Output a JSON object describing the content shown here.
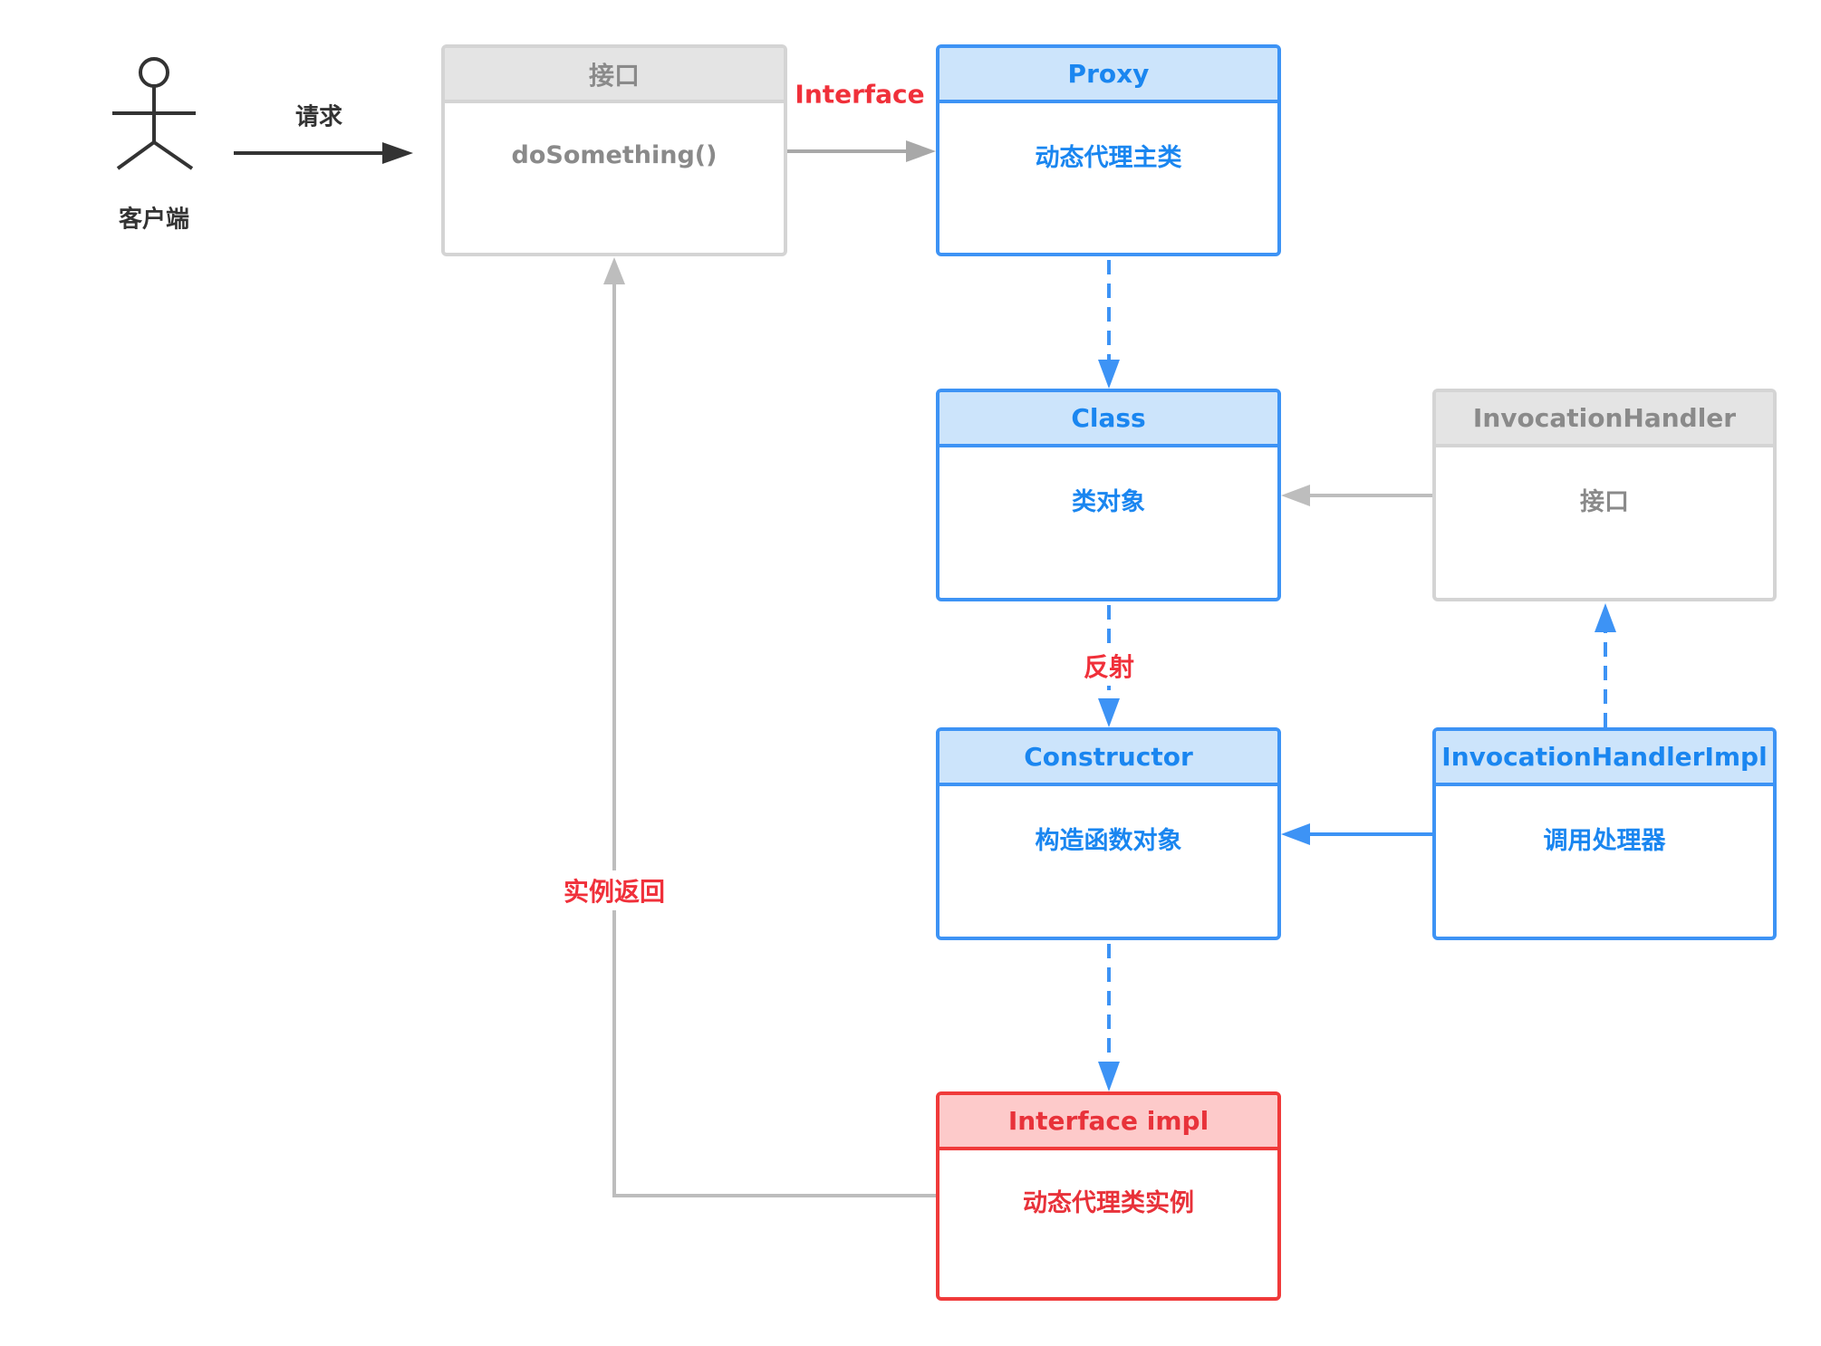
{
  "actor": {
    "label": "客户端"
  },
  "edges": {
    "request": "请求",
    "interface": "Interface",
    "reflection": "反射",
    "instance_return": "实例返回"
  },
  "nodes": {
    "interface_box": {
      "title": "接口",
      "body": "doSomething()"
    },
    "proxy": {
      "title": "Proxy",
      "body": "动态代理主类"
    },
    "class": {
      "title": "Class",
      "body": "类对象"
    },
    "invocation_handler": {
      "title": "InvocationHandler",
      "body": "接口"
    },
    "constructor": {
      "title": "Constructor",
      "body": "构造函数对象"
    },
    "invocation_handler_impl": {
      "title": "InvocationHandlerImpl",
      "body": "调用处理器"
    },
    "interface_impl": {
      "title": "Interface impl",
      "body": "动态代理类实例"
    }
  },
  "colors": {
    "blue": "#3d93f5",
    "gray": "#bdbdbd",
    "red": "#f03a3a",
    "dark": "#333333"
  }
}
